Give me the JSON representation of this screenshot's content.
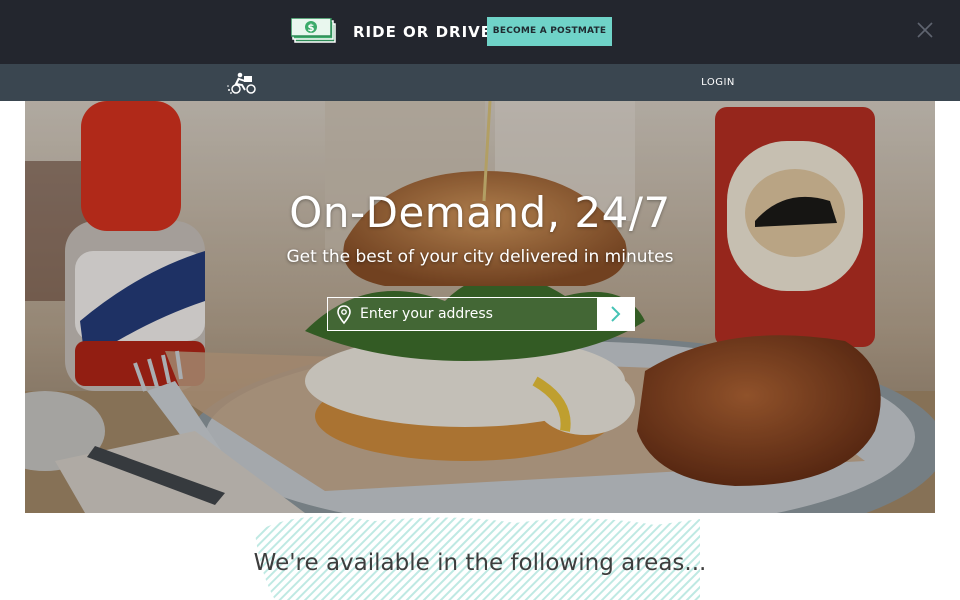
{
  "promo": {
    "money_icon": "dollar-bills-icon",
    "text": "RIDE OR DRIVE",
    "cta_label": "BECOME A POSTMATE",
    "close_icon": "close-icon",
    "background": "#23262e",
    "cta_color": "#6fd3c8"
  },
  "nav": {
    "logo_icon": "postmates-courier-logo-icon",
    "login_label": "LOGIN",
    "background": "#3a4650"
  },
  "hero": {
    "title": "On-Demand, 24/7",
    "subtitle": "Get the best of your city delivered in minutes",
    "address_placeholder": "Enter your address",
    "pin_icon": "location-pin-icon",
    "submit_icon": "chevron-right-icon",
    "image_description": "food photo",
    "accent": "#6fd3c8"
  },
  "areas": {
    "heading": "We're available in the following areas..."
  }
}
